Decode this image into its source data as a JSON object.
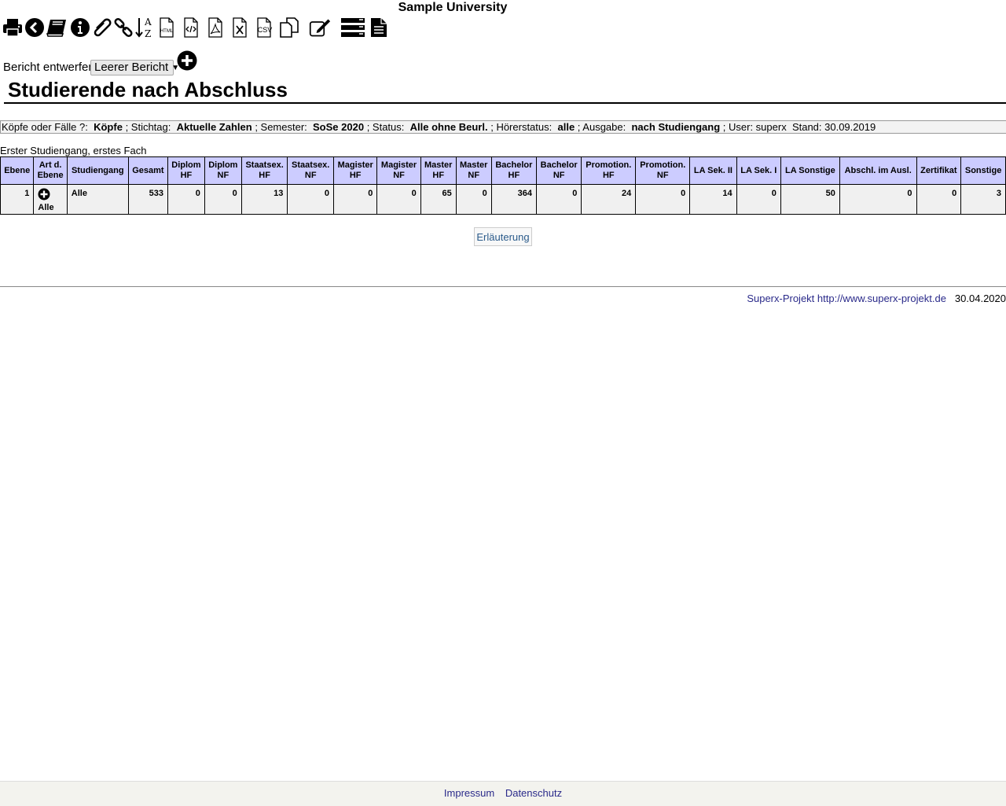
{
  "header": {
    "university": "Sample University"
  },
  "toolbar": {
    "icons": [
      "print-icon",
      "back-icon",
      "books-icon",
      "info-icon",
      "paperclip-icon",
      "link-icon",
      "sort-az-icon",
      "html-export-icon",
      "xml-export-icon",
      "pdf-export-icon",
      "xlsx-export-icon",
      "csv-export-icon",
      "copy-icon",
      "edit-icon",
      "list-icon",
      "document-icon"
    ],
    "html_label": "HTML",
    "csv_label": "CSV",
    "sort_a": "A",
    "sort_z": "Z"
  },
  "design": {
    "label": "Bericht entwerfen:",
    "selected": "Leerer Bericht",
    "arrow": "▼"
  },
  "page_title": "Studierende nach Abschluss",
  "params": {
    "k1": "Köpfe oder Fälle ?:",
    "v1": "Köpfe",
    "k2": "; Stichtag:",
    "v2": "Aktuelle Zahlen",
    "k3": "; Semester:",
    "v3": "SoSe 2020",
    "k4": "; Status:",
    "v4": "Alle ohne Beurl.",
    "k5": "; Hörerstatus:",
    "v5": "alle",
    "k6": "; Ausgabe:",
    "v6": "nach Studiengang",
    "k7": "; User: superx",
    "stand": "Stand: 30.09.2019"
  },
  "table": {
    "caption": "Erster Studiengang, erstes Fach",
    "headers": [
      [
        "Ebene"
      ],
      [
        "Art d.",
        "Ebene"
      ],
      [
        "Studiengang"
      ],
      [
        "Gesamt"
      ],
      [
        "Diplom",
        "HF"
      ],
      [
        "Diplom",
        "NF"
      ],
      [
        "Staatsex.",
        "HF"
      ],
      [
        "Staatsex.",
        "NF"
      ],
      [
        "Magister",
        "HF"
      ],
      [
        "Magister",
        "NF"
      ],
      [
        "Master",
        "HF"
      ],
      [
        "Master",
        "NF"
      ],
      [
        "Bachelor",
        "HF"
      ],
      [
        "Bachelor",
        "NF"
      ],
      [
        "Promotion.",
        "HF"
      ],
      [
        "Promotion.",
        "NF"
      ],
      [
        "LA Sek. II"
      ],
      [
        "LA Sek. I"
      ],
      [
        "LA Sonstige"
      ],
      [
        "Abschl. im Ausl."
      ],
      [
        "Zertifikat"
      ],
      [
        "Sonstige"
      ]
    ],
    "rows": [
      {
        "ebene": "1",
        "art": "Alle",
        "studiengang": "Alle",
        "values": [
          "533",
          "0",
          "0",
          "13",
          "0",
          "0",
          "0",
          "65",
          "0",
          "364",
          "0",
          "24",
          "0",
          "14",
          "0",
          "50",
          "0",
          "0",
          "3"
        ]
      }
    ]
  },
  "explain_button": "Erläuterung",
  "credit": {
    "text": "Superx-Projekt http://www.superx-projekt.de",
    "date": "30.04.2020"
  },
  "footer": {
    "impressum": "Impressum",
    "datenschutz": "Datenschutz"
  }
}
